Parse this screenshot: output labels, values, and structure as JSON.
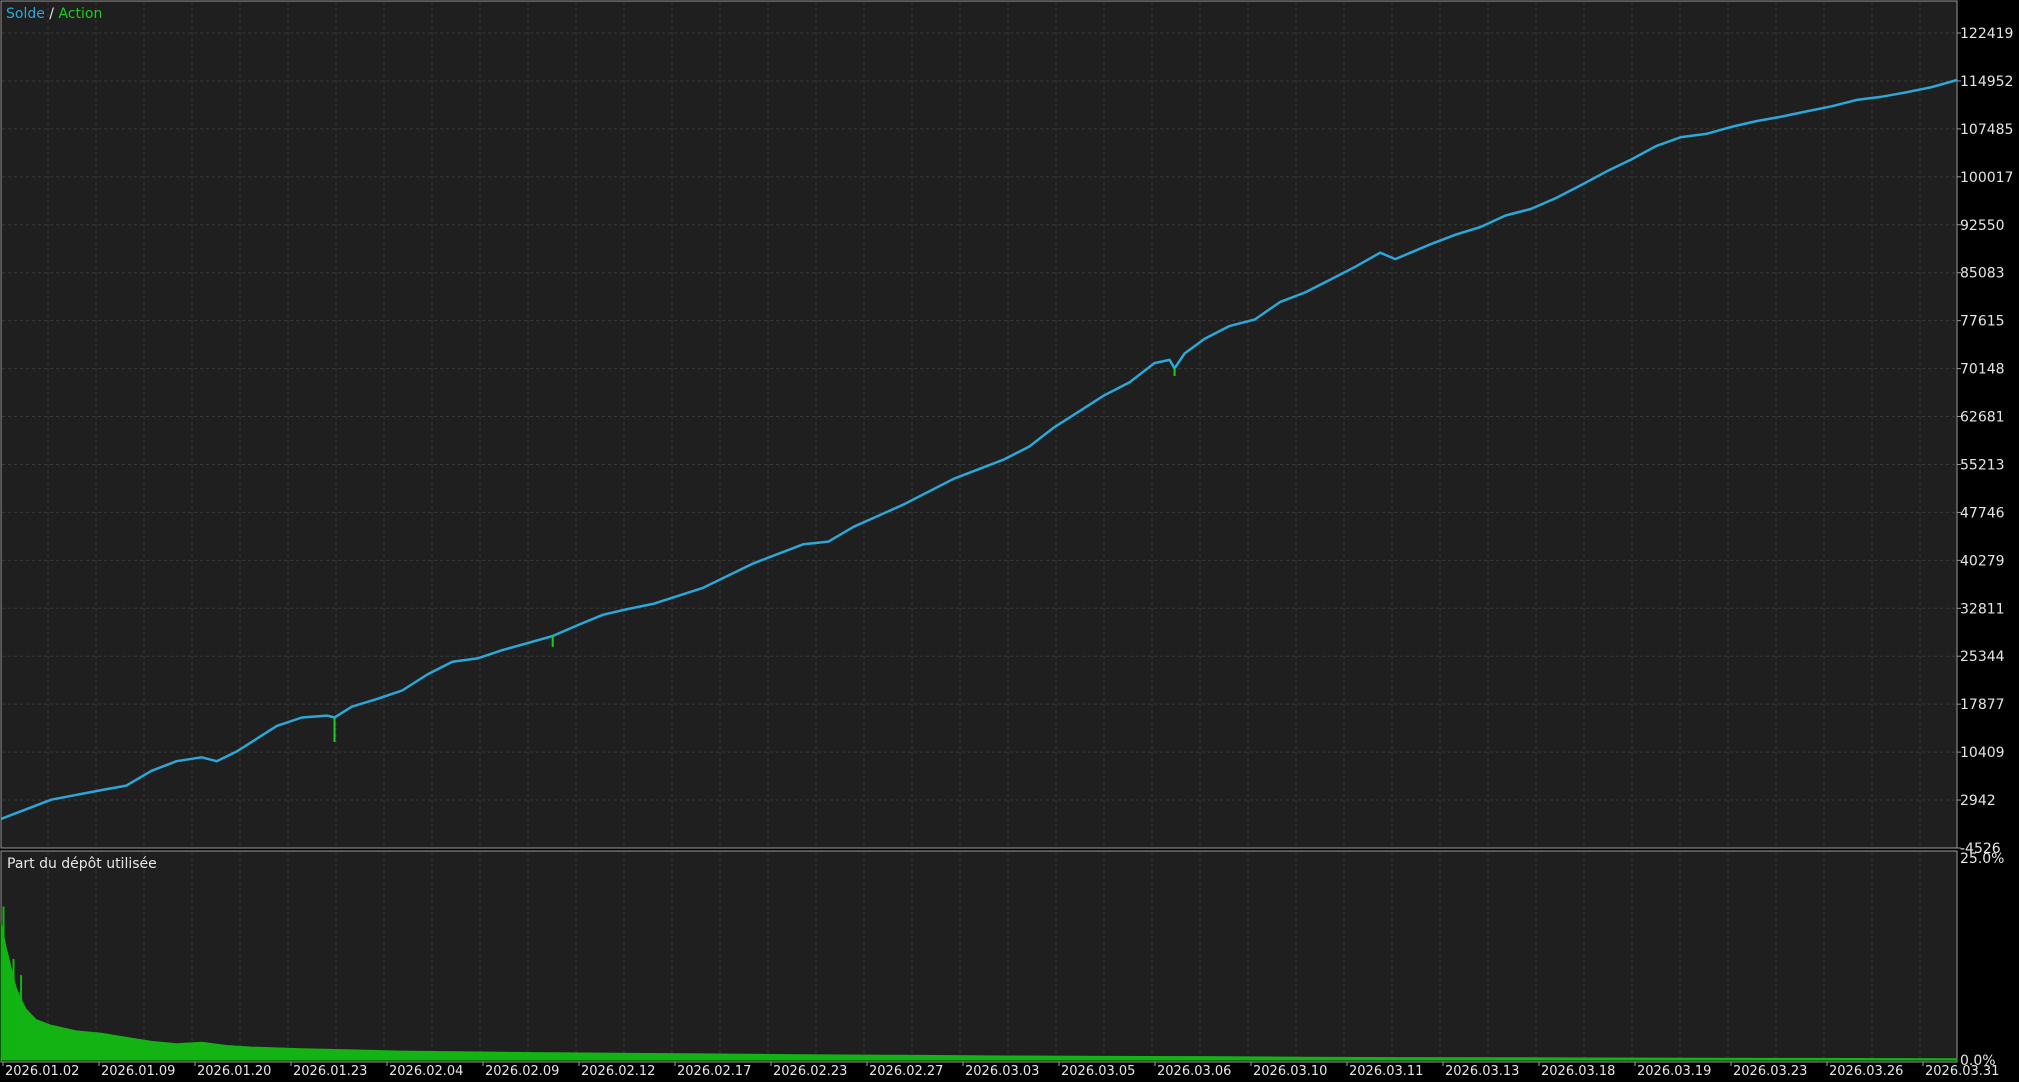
{
  "legend": {
    "balance_label": "Solde",
    "separator": " / ",
    "equity_label": "Action"
  },
  "lower_panel": {
    "title": "Part du dépôt utilisée"
  },
  "colors": {
    "background": "#000000",
    "panel": "#1f1f1f",
    "grid": "#3a3a3a",
    "balance": "#2ba8d8",
    "equity": "#1ecb1e",
    "load": "#12b312",
    "text": "#e6e6e6",
    "border": "#9a9a9a"
  },
  "chart_data": [
    {
      "type": "line",
      "title": "",
      "y_ticks": [
        "122419",
        "114952",
        "107485",
        "100017",
        "92550",
        "85083",
        "77615",
        "70148",
        "62681",
        "55213",
        "47746",
        "40279",
        "32811",
        "25344",
        "17877",
        "10409",
        "2942",
        "-4526"
      ],
      "ylim": [
        -4526,
        122419
      ],
      "grid": true,
      "x_labels": [
        "2026.01.02",
        "2026.01.09",
        "2026.01.20",
        "2026.01.23",
        "2026.02.04",
        "2026.02.09",
        "2026.02.12",
        "2026.02.17",
        "2026.02.23",
        "2026.02.27",
        "2026.03.03",
        "2026.03.05",
        "2026.03.06",
        "2026.03.10",
        "2026.03.11",
        "2026.03.13",
        "2026.03.18",
        "2026.03.19",
        "2026.03.23",
        "2026.03.26",
        "2026.03.31"
      ],
      "series": [
        {
          "name": "Solde",
          "points": [
            [
              0,
              0
            ],
            [
              1,
              3000
            ],
            [
              2,
              4500
            ],
            [
              2.5,
              5200
            ],
            [
              3,
              7500
            ],
            [
              3.5,
              9000
            ],
            [
              4,
              9600
            ],
            [
              4.3,
              9000
            ],
            [
              4.7,
              10500
            ],
            [
              5,
              12000
            ],
            [
              5.5,
              14500
            ],
            [
              6,
              15800
            ],
            [
              6.5,
              16100
            ],
            [
              6.65,
              15800
            ],
            [
              7,
              17500
            ],
            [
              7.5,
              18700
            ],
            [
              8,
              20000
            ],
            [
              8.5,
              22500
            ],
            [
              9,
              24500
            ],
            [
              9.5,
              25000
            ],
            [
              10,
              26300
            ],
            [
              11,
              28500
            ],
            [
              11.5,
              30200
            ],
            [
              12,
              31800
            ],
            [
              12.5,
              32700
            ],
            [
              13,
              33500
            ],
            [
              14,
              36000
            ],
            [
              15,
              39800
            ],
            [
              16,
              42800
            ],
            [
              16.5,
              43200
            ],
            [
              17,
              45500
            ],
            [
              18,
              49000
            ],
            [
              19,
              53000
            ],
            [
              20,
              56000
            ],
            [
              20.5,
              58000
            ],
            [
              21,
              61000
            ],
            [
              21.5,
              63500
            ],
            [
              22,
              66000
            ],
            [
              22.5,
              68000
            ],
            [
              23,
              71000
            ],
            [
              23.3,
              71500
            ],
            [
              23.4,
              70200
            ],
            [
              23.6,
              72500
            ],
            [
              24,
              74800
            ],
            [
              24.5,
              76800
            ],
            [
              25,
              77800
            ],
            [
              25.5,
              80500
            ],
            [
              26,
              82000
            ],
            [
              26.5,
              84000
            ],
            [
              27,
              86000
            ],
            [
              27.5,
              88200
            ],
            [
              27.8,
              87200
            ],
            [
              28.5,
              89500
            ],
            [
              29,
              91000
            ],
            [
              29.5,
              92200
            ],
            [
              30,
              94000
            ],
            [
              30.5,
              95000
            ],
            [
              31,
              96700
            ],
            [
              31.5,
              98700
            ],
            [
              32,
              100800
            ],
            [
              32.5,
              102700
            ],
            [
              33,
              104800
            ],
            [
              33.5,
              106200
            ],
            [
              34,
              106700
            ],
            [
              34.5,
              107800
            ],
            [
              35,
              108700
            ],
            [
              35.5,
              109400
            ],
            [
              36,
              110200
            ],
            [
              36.5,
              111000
            ],
            [
              37,
              112000
            ],
            [
              37.5,
              112500
            ],
            [
              38,
              113200
            ],
            [
              38.5,
              114000
            ],
            [
              39,
              115100
            ]
          ],
          "annotations": [
            {
              "x": 6.65,
              "low": 13600
            },
            {
              "x": 11,
              "low": 27200
            },
            {
              "x": 23.4,
              "low": 69400
            },
            {
              "x": 32,
              "low": 99500
            }
          ]
        },
        {
          "name": "Action",
          "spikes": [
            {
              "x": 6.65,
              "low": 12000
            },
            {
              "x": 11,
              "low": 26800
            },
            {
              "x": 23.4,
              "low": 69000
            }
          ]
        }
      ]
    },
    {
      "type": "area",
      "title": "Part du dépôt utilisée",
      "y_ticks": [
        "25.0%",
        "0.0%"
      ],
      "ylim": [
        0,
        25
      ],
      "series": [
        {
          "name": "Part du dépôt utilisée",
          "points": [
            [
              0,
              17.0
            ],
            [
              0.1,
              14.0
            ],
            [
              0.2,
              11.5
            ],
            [
              0.3,
              9.0
            ],
            [
              0.4,
              7.5
            ],
            [
              0.5,
              6.3
            ],
            [
              0.7,
              5.0
            ],
            [
              1.0,
              4.3
            ],
            [
              1.5,
              3.6
            ],
            [
              2,
              3.3
            ],
            [
              2.5,
              2.8
            ],
            [
              3,
              2.3
            ],
            [
              3.5,
              2.0
            ],
            [
              4,
              2.2
            ],
            [
              4.5,
              1.8
            ],
            [
              5,
              1.6
            ],
            [
              6,
              1.4
            ],
            [
              7,
              1.25
            ],
            [
              8,
              1.1
            ],
            [
              10,
              0.95
            ],
            [
              12,
              0.85
            ],
            [
              14,
              0.75
            ],
            [
              16,
              0.65
            ],
            [
              18,
              0.58
            ],
            [
              20,
              0.5
            ],
            [
              22,
              0.45
            ],
            [
              24,
              0.42
            ],
            [
              26,
              0.35
            ],
            [
              28,
              0.3
            ],
            [
              30,
              0.28
            ],
            [
              32,
              0.25
            ],
            [
              34,
              0.22
            ],
            [
              36,
              0.2
            ],
            [
              39,
              0.15
            ]
          ],
          "spikes": [
            {
              "x": 0.05,
              "high": 19.0
            },
            {
              "x": 0.25,
              "high": 12.5
            },
            {
              "x": 0.4,
              "high": 10.5
            }
          ]
        }
      ]
    }
  ]
}
